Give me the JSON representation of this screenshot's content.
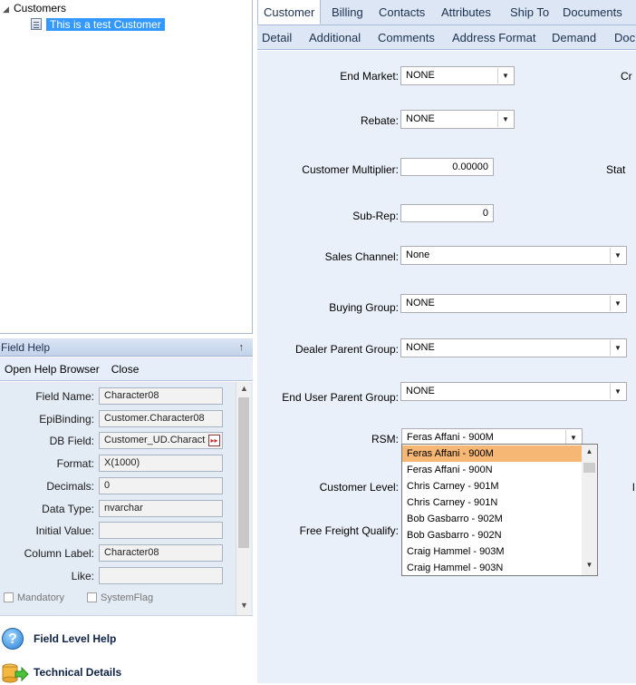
{
  "tree": {
    "root_label": "Customers",
    "child_label": "This is a test Customer"
  },
  "field_help": {
    "title": "Field Help",
    "pin_glyph": "↑",
    "toolbar": {
      "open_help_browser": "Open Help Browser",
      "close": "Close"
    },
    "rows": [
      {
        "label": "Field Name:",
        "value": "Character08"
      },
      {
        "label": "EpiBinding:",
        "value": "Customer.Character08"
      },
      {
        "label": "DB Field:",
        "value": "Customer_UD.Charact"
      },
      {
        "label": "Format:",
        "value": "X(1000)"
      },
      {
        "label": "Decimals:",
        "value": "0"
      },
      {
        "label": "Data Type:",
        "value": "nvarchar"
      },
      {
        "label": "Initial Value:",
        "value": ""
      },
      {
        "label": "Column Label:",
        "value": "Character08"
      },
      {
        "label": "Like:",
        "value": ""
      }
    ],
    "checks": {
      "mandatory": "Mandatory",
      "system_flag": "SystemFlag"
    }
  },
  "help_links": {
    "field_level": "Field Level Help",
    "technical": "Technical Details"
  },
  "tabs_primary": [
    "Customer",
    "Billing",
    "Contacts",
    "Attributes",
    "Ship To",
    "Documents"
  ],
  "tabs_secondary": [
    "Detail",
    "Additional",
    "Comments",
    "Address Format",
    "Demand",
    "Doc"
  ],
  "form": {
    "end_market": {
      "label": "End Market:",
      "value": "NONE"
    },
    "rebate": {
      "label": "Rebate:",
      "value": "NONE"
    },
    "customer_multiplier": {
      "label": "Customer Multiplier:",
      "value": "0.00000"
    },
    "sub_rep": {
      "label": "Sub-Rep:",
      "value": "0"
    },
    "sales_channel": {
      "label": "Sales Channel:",
      "value": "None"
    },
    "buying_group": {
      "label": "Buying Group:",
      "value": "NONE"
    },
    "dealer_parent_group": {
      "label": "Dealer Parent Group:",
      "value": "NONE"
    },
    "end_user_parent_group": {
      "label": "End User Parent Group:",
      "value": "NONE"
    },
    "rsm": {
      "label": "RSM:",
      "value": "Feras Affani - 900M"
    },
    "customer_level": {
      "label": "Customer Level:"
    },
    "free_freight": {
      "label": "Free Freight Qualify:"
    },
    "cut_labels": {
      "cr": "Cr",
      "stat": "Stat",
      "l": "l"
    }
  },
  "rsm_options": [
    "Feras Affani - 900M",
    "Feras Affani - 900N",
    "Chris Carney - 901M",
    "Chris Carney - 901N",
    "Bob Gasbarro - 902M",
    "Bob Gasbarro - 902N",
    "Craig Hammel - 903M",
    "Craig Hammel - 903N"
  ]
}
